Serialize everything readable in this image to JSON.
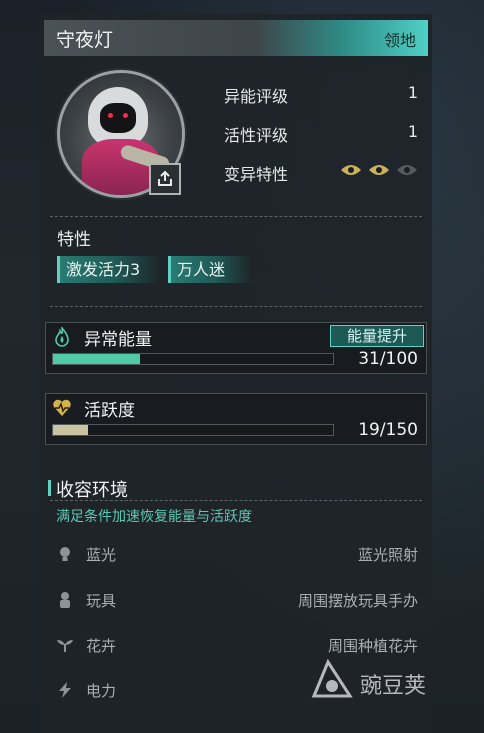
{
  "header": {
    "title": "守夜灯",
    "tag": "领地"
  },
  "stats": [
    {
      "label": "异能评级",
      "value": "1"
    },
    {
      "label": "活性评级",
      "value": "1"
    },
    {
      "label": "变异特性",
      "value": ""
    }
  ],
  "mutation_eyes": {
    "active": 2,
    "total": 3
  },
  "traits": {
    "title": "特性",
    "items": [
      "激发活力3",
      "万人迷"
    ]
  },
  "energy": {
    "label": "异常能量",
    "button": "能量提升",
    "text": "31/100",
    "current": 31,
    "max": 100,
    "color": "#4fc9a8"
  },
  "activity": {
    "label": "活跃度",
    "text": "19/150",
    "current": 19,
    "max": 150,
    "color": "#c9c4a0"
  },
  "environment": {
    "title": "收容环境",
    "subtitle": "满足条件加速恢复能量与活跃度",
    "rows": [
      {
        "icon": "lightbulb-icon",
        "name": "蓝光",
        "value": "蓝光照射"
      },
      {
        "icon": "toy-icon",
        "name": "玩具",
        "value": "周围摆放玩具手办"
      },
      {
        "icon": "plant-icon",
        "name": "花卉",
        "value": "周围种植花卉"
      },
      {
        "icon": "lightning-icon",
        "name": "电力",
        "value": ""
      }
    ]
  },
  "watermark": {
    "text": "豌豆荚"
  },
  "colors": {
    "accent": "#5fd0c4",
    "header_gradient_end": "#4fd0c6"
  }
}
